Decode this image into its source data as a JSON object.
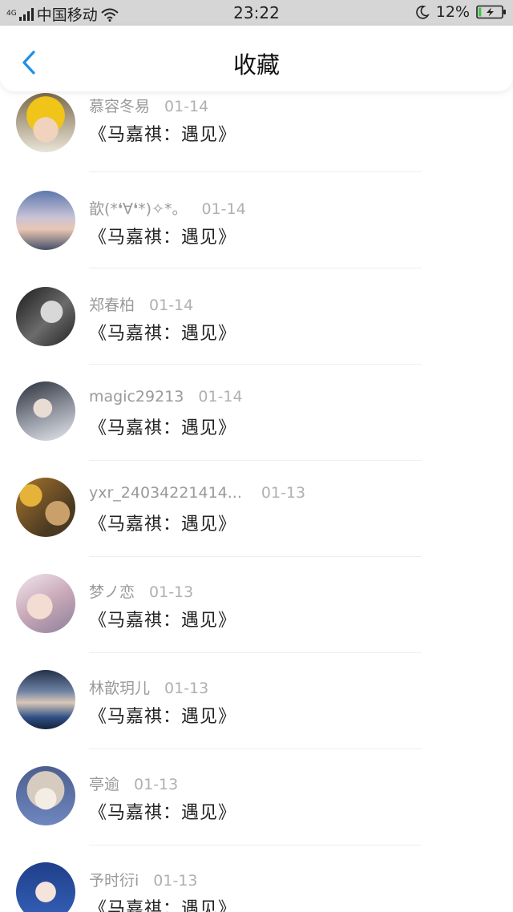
{
  "status_bar": {
    "network": "4G",
    "carrier": "中国移动",
    "time": "23:22",
    "battery": "12%",
    "battery_level": 0.12,
    "icons": [
      "signal-icon",
      "wifi-icon",
      "moon-icon",
      "battery-charging-icon"
    ]
  },
  "header": {
    "title": "收藏",
    "back_icon": "chevron-left-icon",
    "accent_color": "#1e90e8"
  },
  "items": [
    {
      "user": "慕容冬易",
      "date": "01-14",
      "title": "《马嘉祺：遇见》"
    },
    {
      "user": "歆(*❛∀❛*)✧*。",
      "date": "01-14",
      "title": "《马嘉祺：遇见》"
    },
    {
      "user": "郑春柏",
      "date": "01-14",
      "title": "《马嘉祺：遇见》"
    },
    {
      "user": "magic29213",
      "date": "01-14",
      "title": "《马嘉祺：遇见》"
    },
    {
      "user": "yxr_24034221414...",
      "date": "01-13",
      "title": "《马嘉祺：遇见》"
    },
    {
      "user": "梦ノ恋",
      "date": "01-13",
      "title": "《马嘉祺：遇见》"
    },
    {
      "user": "林歆玥儿",
      "date": "01-13",
      "title": "《马嘉祺：遇见》"
    },
    {
      "user": "亭逾",
      "date": "01-13",
      "title": "《马嘉祺：遇见》"
    },
    {
      "user": "予时衍i",
      "date": "01-13",
      "title": "《马嘉祺：遇见》"
    }
  ]
}
